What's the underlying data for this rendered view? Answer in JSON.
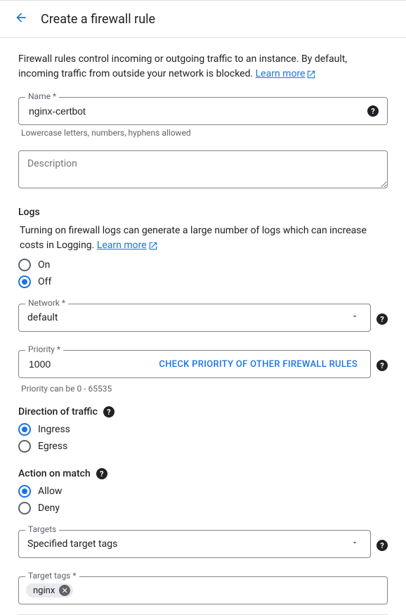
{
  "header": {
    "title": "Create a firewall rule"
  },
  "intro": {
    "text": "Firewall rules control incoming or outgoing traffic to an instance. By default, incoming traffic from outside your network is blocked. ",
    "learn_more": "Learn more"
  },
  "name": {
    "label": "Name *",
    "value": "nginx-certbot",
    "helper": "Lowercase letters, numbers, hyphens allowed"
  },
  "description": {
    "placeholder": "Description"
  },
  "logs": {
    "title": "Logs",
    "desc": "Turning on firewall logs can generate a large number of logs which can increase costs in Logging. ",
    "learn_more": "Learn more",
    "on_label": "On",
    "off_label": "Off",
    "selected": "off"
  },
  "network": {
    "label": "Network *",
    "value": "default"
  },
  "priority": {
    "label": "Priority *",
    "value": "1000",
    "check_link": "CHECK PRIORITY OF OTHER FIREWALL RULES",
    "helper": "Priority can be 0 - 65535"
  },
  "direction": {
    "title": "Direction of traffic",
    "ingress_label": "Ingress",
    "egress_label": "Egress",
    "selected": "ingress"
  },
  "action": {
    "title": "Action on match",
    "allow_label": "Allow",
    "deny_label": "Deny",
    "selected": "allow"
  },
  "targets": {
    "label": "Targets",
    "value": "Specified target tags"
  },
  "target_tags": {
    "label": "Target tags *",
    "chips": [
      "nginx"
    ]
  }
}
